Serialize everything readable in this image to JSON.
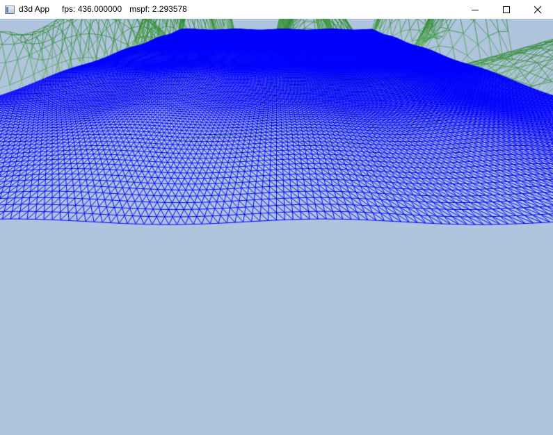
{
  "window": {
    "title": "d3d App",
    "fps_text": "fps: 436.000000",
    "mspf_text": "mspf: 2.293578",
    "controls": {
      "minimize_icon": "minimize-icon",
      "maximize_icon": "maximize-icon",
      "close_icon": "close-icon"
    }
  },
  "scene": {
    "background_color": "#b0c4de",
    "wave_color": "#0000ff",
    "land_color": "#2e8b2e",
    "render_mode": "wireframe"
  }
}
